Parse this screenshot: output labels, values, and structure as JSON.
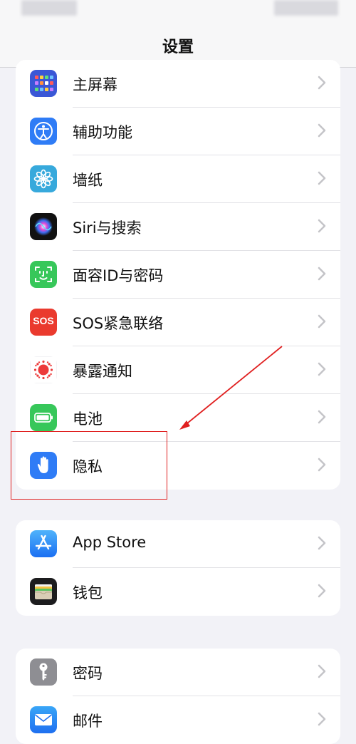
{
  "nav": {
    "title": "设置"
  },
  "group1": [
    {
      "label": "主屏幕",
      "icon": "home-screen-icon"
    },
    {
      "label": "辅助功能",
      "icon": "accessibility-icon"
    },
    {
      "label": "墙纸",
      "icon": "wallpaper-icon"
    },
    {
      "label": "Siri与搜索",
      "icon": "siri-icon"
    },
    {
      "label": "面容ID与密码",
      "icon": "face-id-icon"
    },
    {
      "label": "SOS紧急联络",
      "icon": "sos-icon",
      "icon_text": "SOS"
    },
    {
      "label": "暴露通知",
      "icon": "exposure-notification-icon"
    },
    {
      "label": "电池",
      "icon": "battery-icon"
    },
    {
      "label": "隐私",
      "icon": "privacy-hand-icon"
    }
  ],
  "group2": [
    {
      "label": "App Store",
      "icon": "app-store-icon"
    },
    {
      "label": "钱包",
      "icon": "wallet-icon"
    }
  ],
  "group3": [
    {
      "label": "密码",
      "icon": "key-icon"
    },
    {
      "label": "邮件",
      "icon": "mail-icon"
    }
  ],
  "colors": {
    "accent_red": "#e02020",
    "background": "#f2f2f7"
  }
}
